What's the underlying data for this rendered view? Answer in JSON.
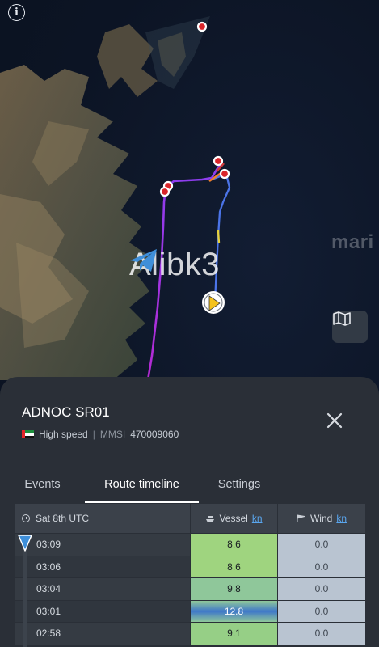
{
  "map": {
    "watermark_text": "Alibk3",
    "brand_fragment": "mari",
    "info_icon": "info-icon",
    "layers_icon": "map-layers-icon"
  },
  "vessel": {
    "name": "ADNOC SR01",
    "flag": "UAE",
    "status": "High speed",
    "separator": "|",
    "mmsi_label": "MMSI",
    "mmsi": "470009060"
  },
  "tabs": [
    {
      "label": "Events",
      "active": false
    },
    {
      "label": "Route timeline",
      "active": true
    },
    {
      "label": "Settings",
      "active": false
    }
  ],
  "timeline": {
    "date_header": "Sat 8th UTC",
    "vessel_header": "Vessel",
    "vessel_unit": "kn",
    "wind_header": "Wind",
    "wind_unit": "kn",
    "rows": [
      {
        "time": "03:09",
        "vessel": "8.6",
        "wind": "0.0",
        "color": "#9fd47f"
      },
      {
        "time": "03:06",
        "vessel": "8.6",
        "wind": "0.0",
        "color": "#9fd47f"
      },
      {
        "time": "03:04",
        "vessel": "9.8",
        "wind": "0.0",
        "color": "#8fc79a"
      },
      {
        "time": "03:01",
        "vessel": "12.8",
        "wind": "0.0",
        "color": "#3f78c9"
      },
      {
        "time": "02:58",
        "vessel": "9.1",
        "wind": "0.0",
        "color": "#96cf86"
      }
    ]
  },
  "colors": {
    "panel_bg": "#2a2f37",
    "route_purple": "#a12cd8",
    "route_blue": "#4b74e8",
    "port_red": "#d9252a",
    "accent_blue": "#5aa6ee",
    "marker_yellow": "#f5c21b"
  }
}
